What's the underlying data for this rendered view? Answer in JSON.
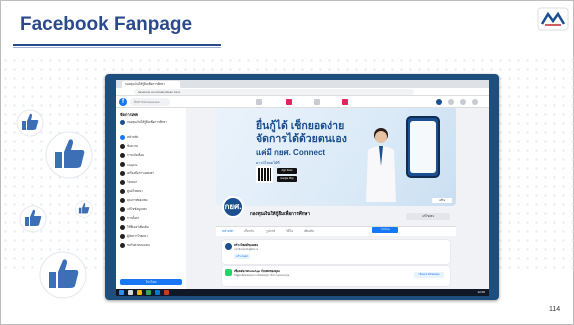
{
  "slide": {
    "title": "Facebook Fanpage",
    "page_number": "114",
    "logo_text": "กยศ."
  },
  "browser": {
    "tab_label": "กองทุนเงินให้กู้ยืมเพื่อการศึกษา",
    "url": "facebook.com/studentloan.fund"
  },
  "facebook": {
    "search_placeholder": "ค้นหาบน Facebook",
    "sidebar": {
      "title": "จัดการเพจ",
      "page_item": "กองทุนเงินให้กู้ยืมเพื่อการศึกษา",
      "items": [
        "หน้าหลัก",
        "ข้อความ",
        "การแจ้งเตือน",
        "Insights",
        "เครื่องมือการเผยแพร่",
        "โฆษณา",
        "ศูนย์โฆษณา",
        "คุณภาพของเพจ",
        "แก้ไขข้อมูลเพจ",
        "การตั้งค่า",
        "ใช้ฟีเจอร์เพิ่มเติม",
        "ผู้จัดการโฆษณา",
        "ขอรับค่าตอบแทน"
      ],
      "promote_button": "โปรโมท"
    },
    "cover": {
      "headline_line1": "ยื่นกู้ได้ เช็กยอดง่าย",
      "headline_line2": "จัดการได้ด้วยตนเอง",
      "headline_line3": "แค่มี กยศ. Connect",
      "download_label": "ดาวน์โหลดได้ที่",
      "store1": "App Store",
      "store2": "Google Play",
      "edit_cover": "แก้ไข"
    },
    "page_name": "กองทุนเงินให้กู้ยืมเพื่อการศึกษา",
    "edit_page_button": "แก้ไขเพจ",
    "profile_badge": "กยศ.",
    "tabs": [
      "หน้าหลัก",
      "เกี่ยวกับ",
      "รูปภาพ",
      "วิดีโอ",
      "เพิ่มเติม"
    ],
    "promote_tab_button": "โปรโมท",
    "card1": {
      "title": "สร้างโพสต์ของเพจ",
      "text": "แชร์อัปเดตกับผู้ติดตาม",
      "button": "สร้างโพสต์"
    },
    "card2": {
      "title": "เชื่อมต่อ WhatsApp กับเพจของคุณ",
      "text": "ให้ผู้คนติดต่อคุณผ่าน WhatsApp ได้จากเพจของคุณ",
      "button": "เชื่อมต่อ WhatsApp"
    },
    "taskbar_time": "12:00"
  },
  "colors": {
    "title_blue": "#2b4a8c",
    "monitor_frame": "#1d4e7e",
    "facebook_blue": "#1877f2",
    "thumb_blue": "#3d6fb6"
  }
}
